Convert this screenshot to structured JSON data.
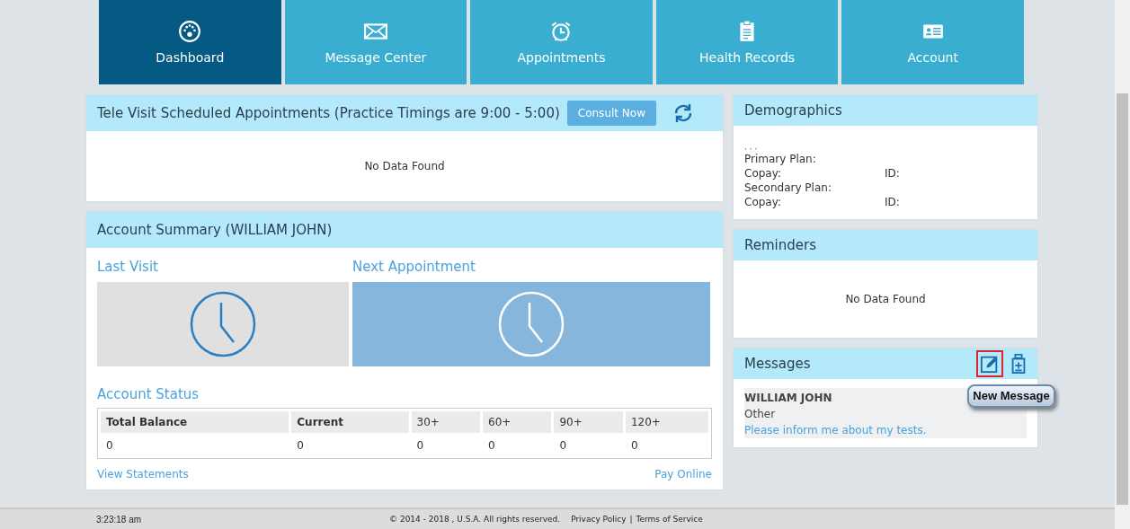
{
  "nav": [
    {
      "label": "Dashboard",
      "kind": "gauge",
      "selected": true
    },
    {
      "label": "Message Center",
      "kind": "envelope",
      "selected": false
    },
    {
      "label": "Appointments",
      "kind": "alarm",
      "selected": false
    },
    {
      "label": "Health Records",
      "kind": "clipboard",
      "selected": false
    },
    {
      "label": "Account",
      "kind": "card",
      "selected": false
    }
  ],
  "tele_visit": {
    "title": "Tele Visit Scheduled Appointments (Practice Timings are 9:00 - 5:00)",
    "button": "Consult Now",
    "empty": "No Data Found"
  },
  "account_summary": {
    "title": "Account Summary (WILLIAM JOHN)",
    "last_visit": "Last Visit",
    "next_appointment": "Next Appointment",
    "status_title": "Account Status",
    "columns": [
      "Total Balance",
      "Current",
      "30+",
      "60+",
      "90+",
      "120+"
    ],
    "rows": [
      [
        "0",
        "0",
        "0",
        "0",
        "0",
        "0"
      ]
    ],
    "view_statements": "View Statements",
    "pay_online": "Pay Online"
  },
  "demographics": {
    "title": "Demographics",
    "name_line": ", , ,",
    "lines": [
      {
        "label": "Primary Plan:"
      },
      {
        "label": "Copay:",
        "id": "ID:"
      },
      {
        "label": "Secondary Plan:"
      },
      {
        "label": "Copay:",
        "id": "ID:"
      }
    ]
  },
  "reminders": {
    "title": "Reminders",
    "empty": "No Data Found"
  },
  "messages": {
    "title": "Messages",
    "items": [
      {
        "sender": "WILLIAM JOHN",
        "category": "Other",
        "subject": "Please inform me about my tests."
      }
    ],
    "callout": "New Message"
  },
  "footer": {
    "time": "3:23:18 am",
    "copyright": "© 2014 - 2018 , U.S.A. All rights reserved.",
    "links": [
      "Privacy Policy",
      "Terms of Service"
    ],
    "separator": "|"
  }
}
